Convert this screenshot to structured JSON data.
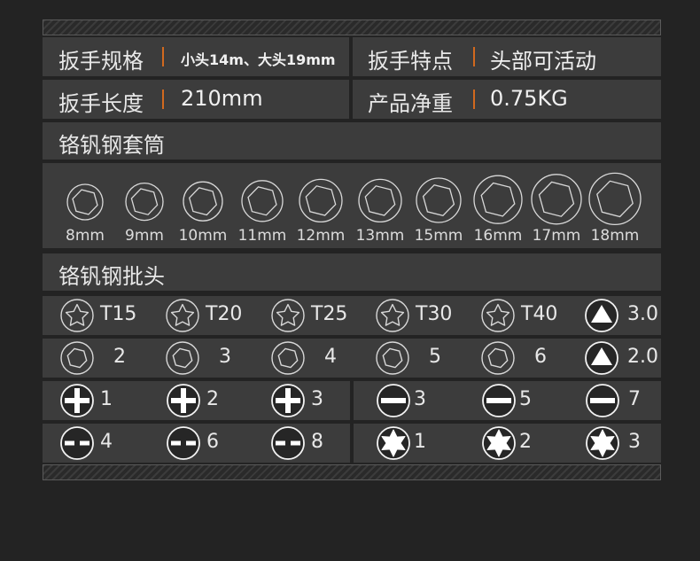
{
  "specs": {
    "row1": {
      "label_a": "扳手规格",
      "value_a": "小头14m、大头19mm",
      "label_b": "扳手特点",
      "value_b": "头部可活动"
    },
    "row2": {
      "label_a": "扳手长度",
      "value_a": "210mm",
      "label_b": "产品净重",
      "value_b": "0.75KG"
    }
  },
  "sockets": {
    "title": "铬钒钢套筒",
    "sizes": [
      "8mm",
      "9mm",
      "10mm",
      "11mm",
      "12mm",
      "13mm",
      "15mm",
      "16mm",
      "17mm",
      "18mm"
    ]
  },
  "bits": {
    "title": "铬钒钢批头",
    "torx": [
      "T15",
      "T20",
      "T25",
      "T30",
      "T40"
    ],
    "triangle": [
      "3.0",
      "2.0"
    ],
    "hex": [
      "2",
      "3",
      "4",
      "5",
      "6"
    ],
    "phillips": [
      "1",
      "2",
      "3"
    ],
    "slotted": [
      "3",
      "5",
      "7"
    ],
    "spanner": [
      "4",
      "6",
      "8"
    ],
    "star": [
      "1",
      "2",
      "3"
    ]
  }
}
